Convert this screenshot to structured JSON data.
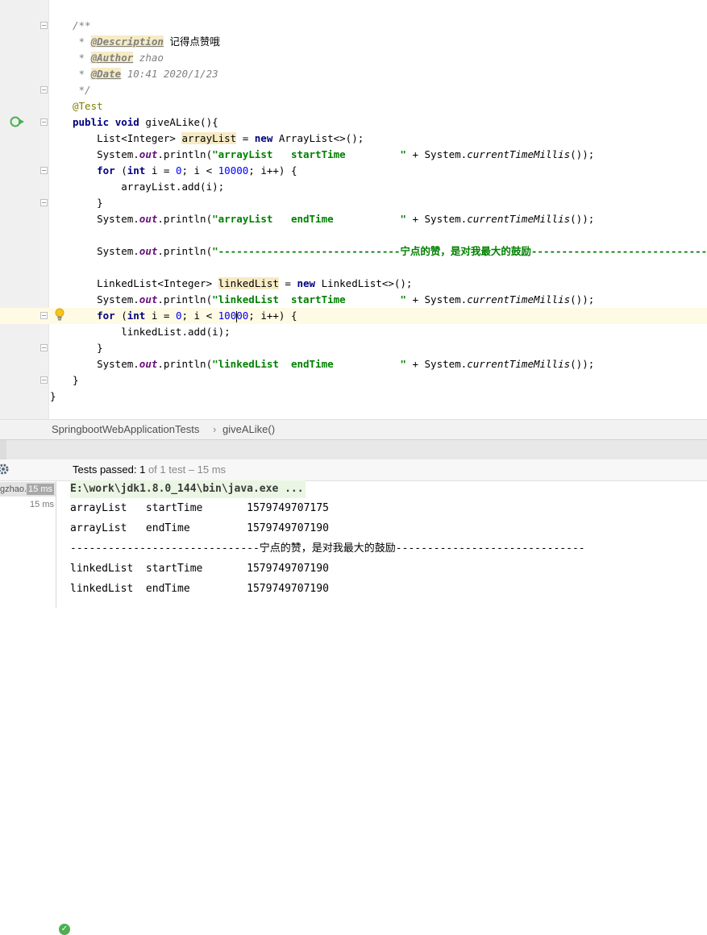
{
  "editor": {
    "lines": [
      [
        {
          "c": "cm",
          "t": "/**"
        }
      ],
      [
        {
          "c": "cm",
          "t": " * "
        },
        {
          "c": "tag",
          "t": "@Description"
        },
        {
          "c": "",
          "t": " 记得点赞哦"
        }
      ],
      [
        {
          "c": "cm",
          "t": " * "
        },
        {
          "c": "tag",
          "t": "@Author"
        },
        {
          "c": "cm",
          "t": " zhao"
        }
      ],
      [
        {
          "c": "cm",
          "t": " * "
        },
        {
          "c": "tag",
          "t": "@Date"
        },
        {
          "c": "cm",
          "t": " 10:41 2020/1/23"
        }
      ],
      [
        {
          "c": "cm",
          "t": " */"
        }
      ],
      [
        {
          "c": "ann",
          "t": "@Test"
        }
      ],
      [
        {
          "c": "kw",
          "t": "public"
        },
        {
          "c": "",
          "t": " "
        },
        {
          "c": "kw",
          "t": "void"
        },
        {
          "c": "",
          "t": " giveALike(){"
        }
      ],
      [
        {
          "c": "",
          "t": "    List<Integer> "
        },
        {
          "c": "var",
          "t": "arrayList"
        },
        {
          "c": "",
          "t": " = "
        },
        {
          "c": "kw",
          "t": "new"
        },
        {
          "c": "",
          "t": " ArrayList<>();"
        }
      ],
      [
        {
          "c": "",
          "t": "    System."
        },
        {
          "c": "fld",
          "t": "out"
        },
        {
          "c": "",
          "t": ".println("
        },
        {
          "c": "str",
          "t": "\"arrayList   startTime         \""
        },
        {
          "c": "",
          "t": " + System."
        },
        {
          "c": "sm",
          "t": "currentTimeMillis"
        },
        {
          "c": "",
          "t": "());"
        }
      ],
      [
        {
          "c": "",
          "t": "    "
        },
        {
          "c": "kw",
          "t": "for"
        },
        {
          "c": "",
          "t": " ("
        },
        {
          "c": "kw",
          "t": "int"
        },
        {
          "c": "",
          "t": " i = "
        },
        {
          "c": "num",
          "t": "0"
        },
        {
          "c": "",
          "t": "; i < "
        },
        {
          "c": "num",
          "t": "10000"
        },
        {
          "c": "",
          "t": "; i++) {"
        }
      ],
      [
        {
          "c": "",
          "t": "        arrayList.add(i);"
        }
      ],
      [
        {
          "c": "",
          "t": "    }"
        }
      ],
      [
        {
          "c": "",
          "t": "    System."
        },
        {
          "c": "fld",
          "t": "out"
        },
        {
          "c": "",
          "t": ".println("
        },
        {
          "c": "str",
          "t": "\"arrayList   endTime           \""
        },
        {
          "c": "",
          "t": " + System."
        },
        {
          "c": "sm",
          "t": "currentTimeMillis"
        },
        {
          "c": "",
          "t": "());"
        }
      ],
      [],
      [
        {
          "c": "",
          "t": "    System."
        },
        {
          "c": "fld",
          "t": "out"
        },
        {
          "c": "",
          "t": ".println("
        },
        {
          "c": "str",
          "t": "\"------------------------------宁点的赞，是对我最大的鼓励------------------------------\""
        },
        {
          "c": "",
          "t": ");"
        }
      ],
      [],
      [
        {
          "c": "",
          "t": "    LinkedList<Integer> "
        },
        {
          "c": "var",
          "t": "linkedList"
        },
        {
          "c": "",
          "t": " = "
        },
        {
          "c": "kw",
          "t": "new"
        },
        {
          "c": "",
          "t": " LinkedList<>();"
        }
      ],
      [
        {
          "c": "",
          "t": "    System."
        },
        {
          "c": "fld",
          "t": "out"
        },
        {
          "c": "",
          "t": ".println("
        },
        {
          "c": "str",
          "t": "\"linkedList  startTime         \""
        },
        {
          "c": "",
          "t": " + System."
        },
        {
          "c": "sm",
          "t": "currentTimeMillis"
        },
        {
          "c": "",
          "t": "());"
        }
      ],
      [
        {
          "c": "",
          "t": "    "
        },
        {
          "c": "kw",
          "t": "for"
        },
        {
          "c": "",
          "t": " ("
        },
        {
          "c": "kw",
          "t": "int"
        },
        {
          "c": "",
          "t": " i = "
        },
        {
          "c": "num",
          "t": "0"
        },
        {
          "c": "",
          "t": "; i < "
        },
        {
          "c": "num",
          "t": "100"
        },
        {
          "c": "caret",
          "t": ""
        },
        {
          "c": "num",
          "t": "00"
        },
        {
          "c": "",
          "t": "; i++) {"
        }
      ],
      [
        {
          "c": "",
          "t": "        linkedList.add(i);"
        }
      ],
      [
        {
          "c": "",
          "t": "    }"
        }
      ],
      [
        {
          "c": "",
          "t": "    System."
        },
        {
          "c": "fld",
          "t": "out"
        },
        {
          "c": "",
          "t": ".println("
        },
        {
          "c": "str",
          "t": "\"linkedList  endTime           \""
        },
        {
          "c": "",
          "t": " + System."
        },
        {
          "c": "sm",
          "t": "currentTimeMillis"
        },
        {
          "c": "",
          "t": "());"
        }
      ],
      [
        {
          "c": "",
          "t": "}"
        }
      ],
      [
        {
          "c": "",
          "t": "}"
        }
      ]
    ],
    "indent_levels": [
      1,
      1,
      1,
      1,
      1,
      1,
      1,
      1,
      1,
      1,
      1,
      1,
      1,
      1,
      1,
      1,
      1,
      1,
      1,
      1,
      1,
      1,
      1,
      0
    ]
  },
  "breadcrumb": {
    "class_name": "SpringbootWebApplicationTests",
    "separator": "›",
    "method_name": "giveALike()"
  },
  "run_status": {
    "label": "Tests passed: ",
    "passed": "1",
    "rest": " of 1 test – 15 ms"
  },
  "test_tree": [
    {
      "name": "gzhao.",
      "time": "15 ms"
    },
    {
      "name": "",
      "time": "15 ms"
    }
  ],
  "console": {
    "command": "E:\\work\\jdk1.8.0_144\\bin\\java.exe ...",
    "output": [
      "arrayList   startTime       1579749707175",
      "arrayList   endTime         1579749707190",
      "------------------------------宁点的赞，是对我最大的鼓励------------------------------",
      "linkedList  startTime       1579749707190",
      "linkedList  endTime         1579749707190"
    ]
  },
  "colors": {
    "keyword": "#000080",
    "string": "#008000",
    "number": "#0000ff",
    "comment": "#808080",
    "annotation": "#808000",
    "field": "#660e7a",
    "passed": "#4caf50"
  },
  "icons": [
    "fold-marker-icon",
    "run-test-gutter-icon",
    "intention-bulb-icon",
    "settings-gear-icon",
    "passed-check-icon"
  ]
}
